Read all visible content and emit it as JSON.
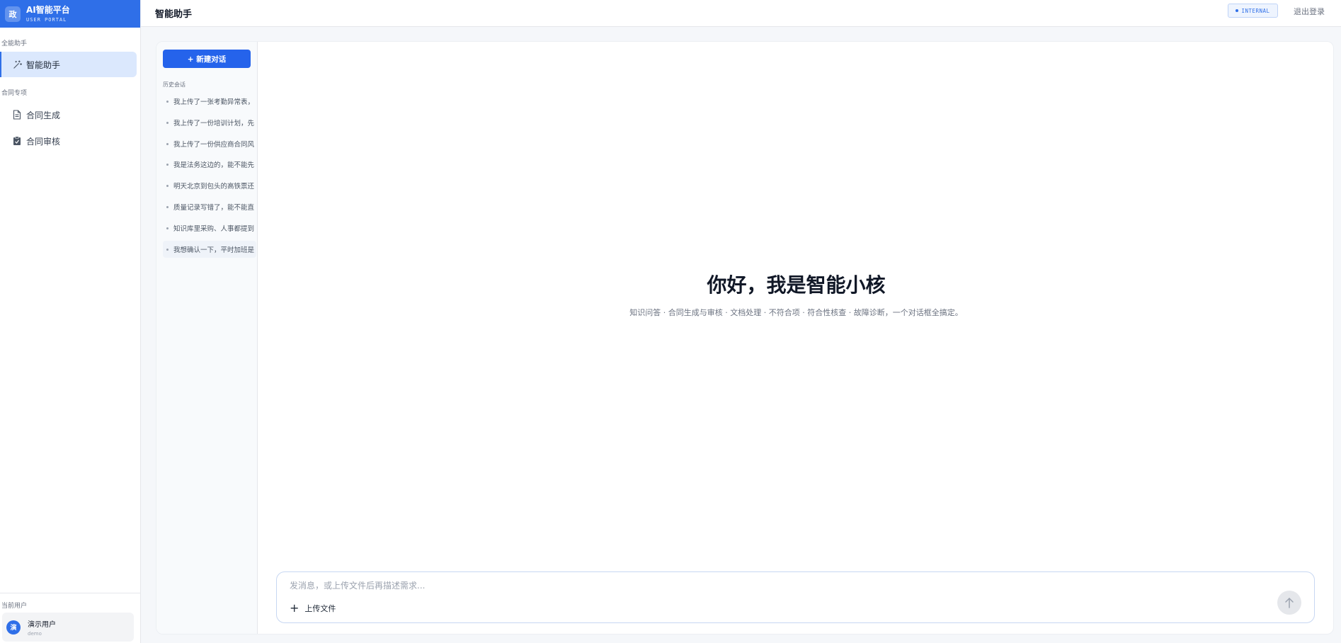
{
  "brand": {
    "logo_char": "政",
    "title": "AI智能平台",
    "subtitle": "USER PORTAL",
    "color": "#2f6fe8"
  },
  "sidebar": {
    "sections": [
      {
        "label": "全能助手",
        "items": [
          {
            "label": "智能助手",
            "icon": "sparkle-icon",
            "active": true
          }
        ]
      },
      {
        "label": "合同专项",
        "items": [
          {
            "label": "合同生成",
            "icon": "document-icon"
          },
          {
            "label": "合同审核",
            "icon": "clipboard-check-icon"
          }
        ]
      }
    ],
    "user": {
      "section_label": "当前用户",
      "avatar_char": "演",
      "name": "演示用户",
      "id": "demo"
    }
  },
  "topbar": {
    "title": "智能助手",
    "badge": "INTERNAL",
    "logout": "退出登录"
  },
  "history": {
    "new_chat": "+ 新建对话",
    "label": "历史会话",
    "items": [
      "我上传了一张考勤异常表，",
      "我上传了一份培训计划，先",
      "我上传了一份供应商合同风",
      "我是法务这边的，能不能先",
      "明天北京到包头的高铁票还",
      "质量记录写错了，能不能直",
      "知识库里采购、人事都提到",
      "我想确认一下，平时加班是"
    ]
  },
  "hero": {
    "title": "你好，我是智能小核",
    "subtitle": "知识问答 · 合同生成与审核 · 文档处理 · 不符合项 · 符合性核查 · 故障诊断，一个对话框全搞定。"
  },
  "composer": {
    "placeholder": "发消息，或上传文件后再描述需求...",
    "upload_label": "上传文件",
    "send_icon": "arrow-up-icon"
  }
}
